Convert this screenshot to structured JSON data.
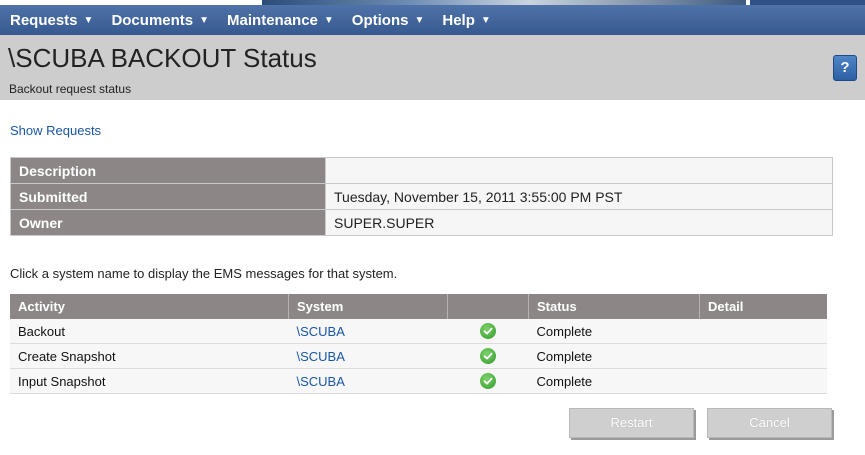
{
  "menu": {
    "items": [
      {
        "label": "Requests"
      },
      {
        "label": "Documents"
      },
      {
        "label": "Maintenance"
      },
      {
        "label": "Options"
      },
      {
        "label": "Help"
      }
    ]
  },
  "header": {
    "title": "\\SCUBA BACKOUT Status",
    "subtitle": "Backout request status",
    "help_label": "?"
  },
  "show_requests_link": "Show Requests",
  "info_table": [
    {
      "label": "Description",
      "value": ""
    },
    {
      "label": "Submitted",
      "value": "Tuesday, November 15, 2011 3:55:00 PM PST"
    },
    {
      "label": "Owner",
      "value": "SUPER.SUPER"
    }
  ],
  "hint": "Click a system name to display the EMS messages for that system.",
  "activity_table": {
    "headers": [
      "Activity",
      "System",
      "",
      "Status",
      "Detail"
    ],
    "rows": [
      {
        "activity": "Backout",
        "system": "\\SCUBA",
        "status_icon": "check-circle-icon",
        "status": "Complete",
        "detail": ""
      },
      {
        "activity": "Create Snapshot",
        "system": "\\SCUBA",
        "status_icon": "check-circle-icon",
        "status": "Complete",
        "detail": ""
      },
      {
        "activity": "Input Snapshot",
        "system": "\\SCUBA",
        "status_icon": "check-circle-icon",
        "status": "Complete",
        "detail": ""
      }
    ]
  },
  "buttons": {
    "restart": "Restart",
    "cancel": "Cancel"
  },
  "colors": {
    "menubar": "#3f63a0",
    "header_bg": "#cdcdcd",
    "table_header": "#8c8786",
    "link": "#1a56a8",
    "success": "#2f9a2a"
  }
}
